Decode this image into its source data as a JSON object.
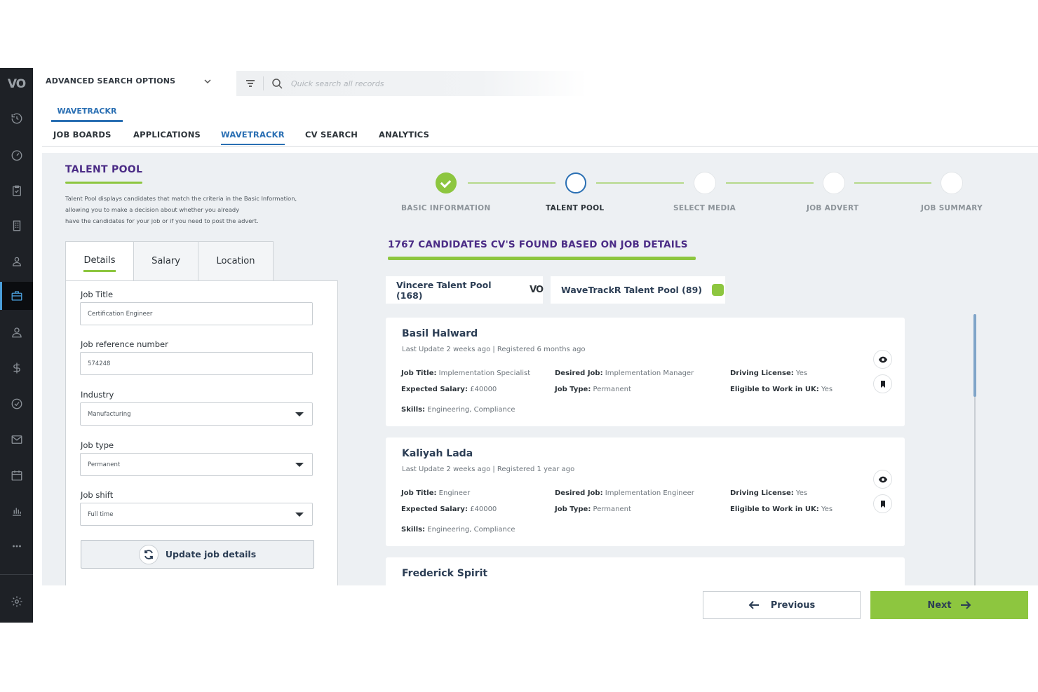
{
  "rail": {
    "logo": "VO",
    "items": [
      {
        "icon": "history-icon"
      },
      {
        "icon": "dashboard-icon"
      },
      {
        "icon": "clipboard-icon"
      },
      {
        "icon": "building-icon"
      },
      {
        "icon": "contacts-icon"
      },
      {
        "icon": "briefcase-icon",
        "active": true
      },
      {
        "icon": "person-icon"
      },
      {
        "icon": "dollar-icon"
      },
      {
        "icon": "check-circle-icon"
      },
      {
        "icon": "mail-icon"
      },
      {
        "icon": "calendar-icon"
      },
      {
        "icon": "bar-chart-icon"
      },
      {
        "icon": "more-icon"
      },
      {
        "icon": "settings-icon"
      }
    ]
  },
  "topbar": {
    "advanced_search_label": "ADVANCED SEARCH OPTIONS",
    "search_placeholder": "Quick search all records"
  },
  "subhead": {
    "tab_label": "WAVETRACKR"
  },
  "mainnav": {
    "items": [
      "JOB BOARDS",
      "APPLICATIONS",
      "WAVETRACKR",
      "CV SEARCH",
      "ANALYTICS"
    ],
    "active": "WAVETRACKR"
  },
  "talent_pool": {
    "title": "TALENT POOL",
    "description_lines": [
      "Talent Pool displays candidates that match the criteria in the Basic Information,",
      "allowing you to make a decision about whether you already",
      "have the candidates for your job or if you need to post the advert."
    ]
  },
  "form": {
    "tabs": [
      "Details",
      "Salary",
      "Location"
    ],
    "active_tab": "Details",
    "fields": {
      "job_title": {
        "label": "Job Title",
        "value": "Certification Engineer"
      },
      "job_ref": {
        "label": "Job reference number",
        "value": "574248"
      },
      "industry": {
        "label": "Industry",
        "value": "Manufacturing"
      },
      "job_type": {
        "label": "Job type",
        "value": "Permanent"
      },
      "job_shift": {
        "label": "Job shift",
        "value": "Full time"
      }
    },
    "update_label": "Update job details"
  },
  "stepper": {
    "steps": [
      "BASIC INFORMATION",
      "TALENT POOL",
      "SELECT MEDIA",
      "JOB ADVERT",
      "JOB SUMMARY"
    ],
    "current": "TALENT POOL",
    "completed": [
      "BASIC INFORMATION"
    ]
  },
  "results": {
    "heading": "1767 CANDIDATES CV'S FOUND BASED ON JOB DETAILS",
    "pools": [
      "Vincere Talent Pool (168)",
      "WaveTrackR Talent Pool (89)"
    ],
    "pool_vo_logo": "VO",
    "labels": {
      "job_title": "Job Title:",
      "desired_job": "Desired Job:",
      "driving_license": "Driving License:",
      "expected_salary": "Expected Salary:",
      "job_type": "Job Type:",
      "eligible": "Eligible to Work in UK:",
      "skills": "Skills:"
    },
    "candidates": [
      {
        "name": "Basil Halward",
        "meta": "Last Update 2 weeks ago | Registered 6 months ago",
        "job_title": "Implementation Specialist",
        "desired_job": "Implementation Manager",
        "driving_license": "Yes",
        "expected_salary": "£40000",
        "job_type": "Permanent",
        "eligible": "Yes",
        "skills": "Engineering, Compliance"
      },
      {
        "name": "Kaliyah Lada",
        "meta": "Last Update 2 weeks ago | Registered 1 year ago",
        "job_title": "Engineer",
        "desired_job": "Implementation Engineer",
        "driving_license": "Yes",
        "expected_salary": "£40000",
        "job_type": "Permanent",
        "eligible": "Yes",
        "skills": "Engineering, Compliance"
      },
      {
        "name": "Frederick Spirit"
      }
    ]
  },
  "footer": {
    "previous_label": "Previous",
    "next_label": "Next"
  },
  "colors": {
    "accent_green": "#8dc63f",
    "brand_purple": "#4b2c86",
    "link_blue": "#2a6fb3",
    "rail_bg": "#1e2126"
  }
}
